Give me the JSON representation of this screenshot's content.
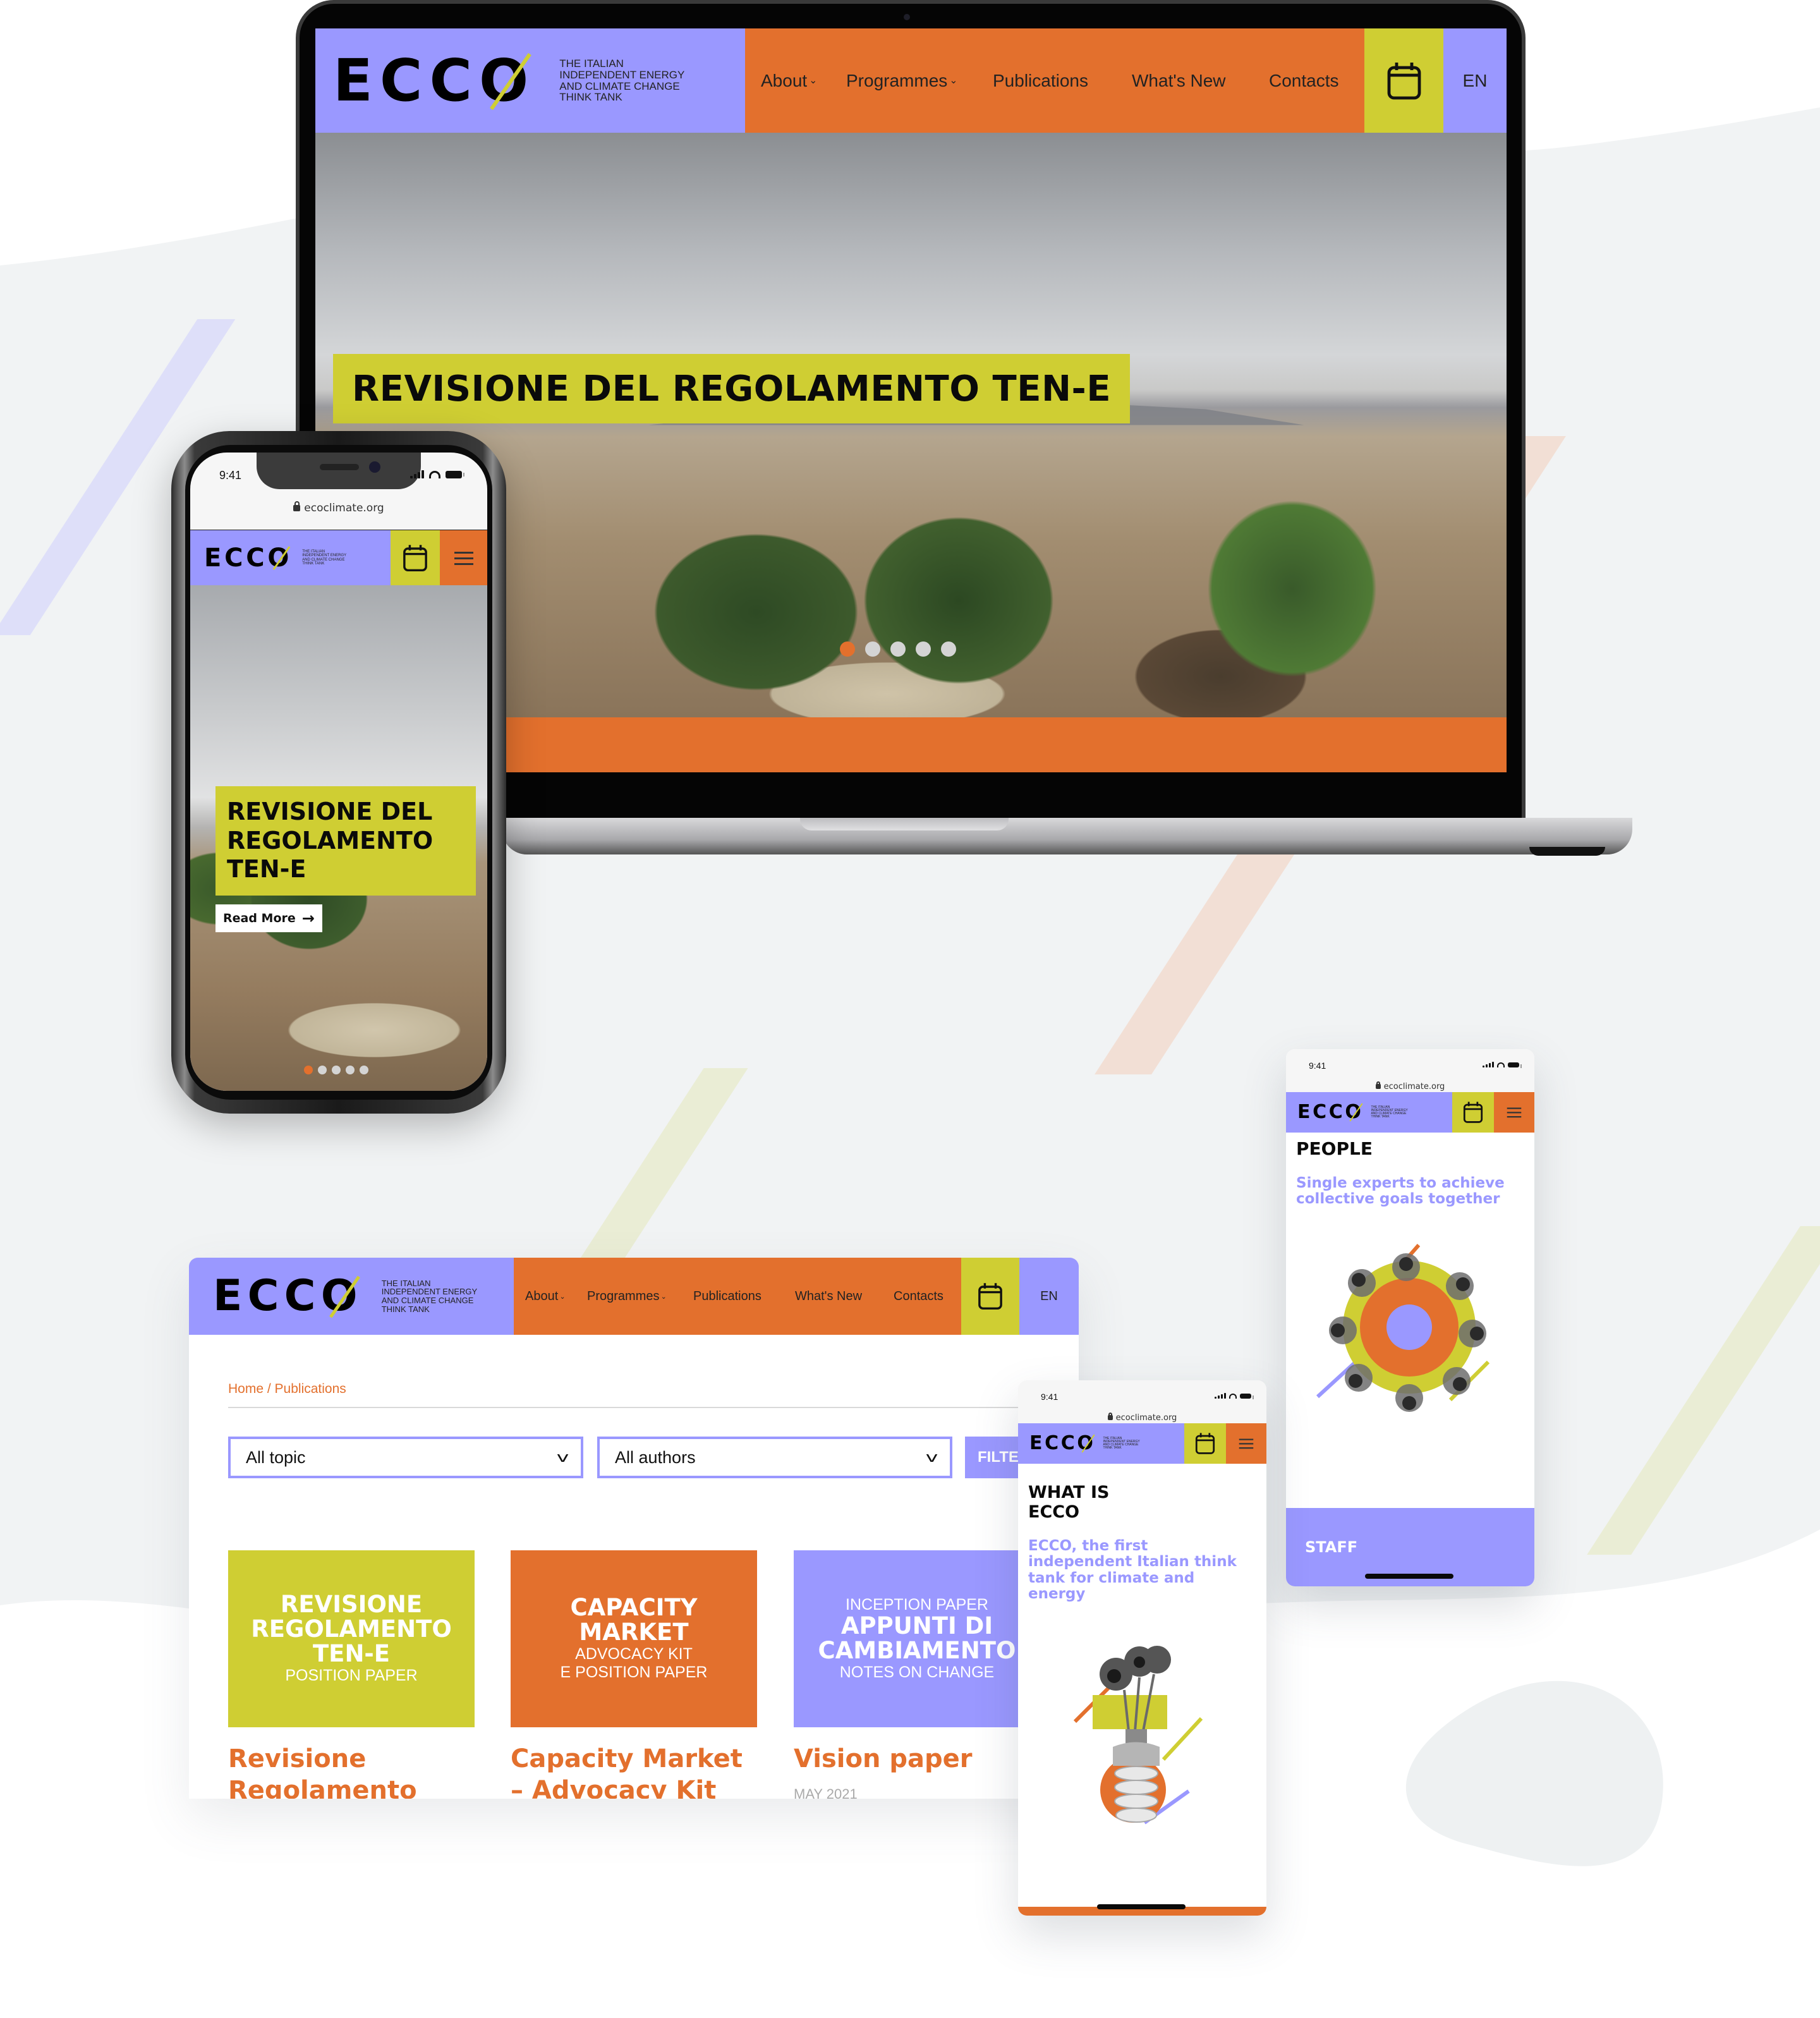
{
  "brand": {
    "logo_text": "ECCO",
    "tagline_lines": [
      "THE ITALIAN",
      "INDEPENDENT ENERGY",
      "AND CLIMATE CHANGE",
      "THINK TANK"
    ],
    "colors": {
      "purple": "#9a98ff",
      "orange": "#e3702d",
      "lime": "#cfce33",
      "black": "#0a0a0a"
    }
  },
  "nav": {
    "items": [
      {
        "label": "About",
        "has_dropdown": true
      },
      {
        "label": "Programmes",
        "has_dropdown": true
      },
      {
        "label": "Publications",
        "has_dropdown": false
      },
      {
        "label": "What's New",
        "has_dropdown": false
      },
      {
        "label": "Contacts",
        "has_dropdown": false
      }
    ],
    "calendar_icon": "calendar-icon",
    "menu_icon": "hamburger-icon",
    "language": "EN",
    "chevron": "⌄"
  },
  "laptop": {
    "hero_title": "REVISIONE DEL REGOLAMENTO TEN-E",
    "slider": {
      "total": 5,
      "active_index": 0
    }
  },
  "phone_status": {
    "time": "9:41",
    "url": "ecoclimate.org"
  },
  "phone_home": {
    "hero_title_lines": [
      "REVISIONE DEL",
      "REGOLAMENTO",
      "TEN-E"
    ],
    "read_more": "Read More",
    "arrow": "→",
    "slider": {
      "total": 5,
      "active_index": 0
    }
  },
  "publications_page": {
    "breadcrumb": {
      "home": "Home",
      "separator": " / ",
      "current": "Publications"
    },
    "filters": {
      "topic": {
        "selected": "All topic"
      },
      "authors": {
        "selected": "All authors"
      },
      "filter_button": "FILTER",
      "chevron": "v"
    },
    "cards": [
      {
        "pre": "",
        "big_lines": [
          "REVISIONE",
          "REGOLAMENTO",
          "TEN-E"
        ],
        "sub_lines": [
          "POSITION PAPER"
        ],
        "color": "#cfce33",
        "title_lines": [
          "Revisione",
          "Regolamento"
        ],
        "date": ""
      },
      {
        "pre": "",
        "big_lines": [
          "CAPACITY",
          "MARKET"
        ],
        "sub_lines": [
          "ADVOCACY KIT",
          "E POSITION PAPER"
        ],
        "color": "#e3702d",
        "title_lines": [
          "Capacity Market",
          "– Advocacy Kit"
        ],
        "date": ""
      },
      {
        "pre": "INCEPTION PAPER",
        "big_lines": [
          "APPUNTI DI",
          "CAMBIAMENTO"
        ],
        "sub_lines": [
          "NOTES ON CHANGE"
        ],
        "color": "#9a98ff",
        "title_lines": [
          "Vision paper"
        ],
        "date": "MAY 2021"
      }
    ]
  },
  "phone_about": {
    "heading_lines": [
      "WHAT IS",
      "ECCO"
    ],
    "lead_lines": [
      "ECCO, the first",
      "independent Italian think",
      "tank for climate and",
      "energy"
    ],
    "illustration": "lightbulb-sunflowers-collage"
  },
  "phone_people": {
    "heading": "PEOPLE",
    "lead_lines": [
      "Single experts to achieve",
      "collective goals together"
    ],
    "illustration": "people-around-table-collage",
    "section_label": "STAFF"
  }
}
